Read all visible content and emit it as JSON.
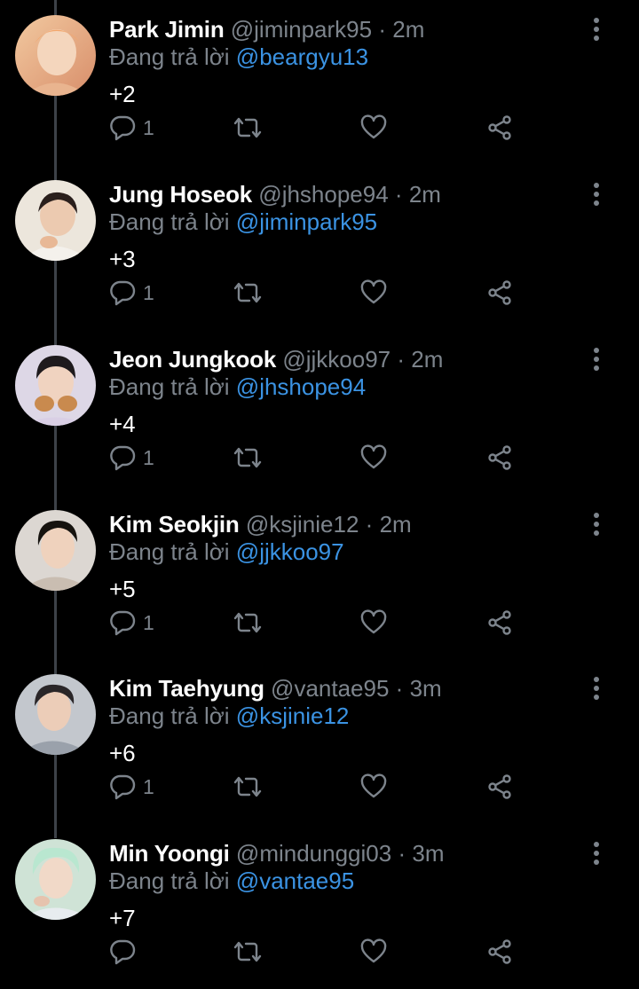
{
  "reply_prefix": "Đang trả lời",
  "colors": {
    "background": "#000000",
    "name": "#ffffff",
    "muted": "#7d848c",
    "link": "#3b93e3",
    "thread_line": "#3d4248"
  },
  "icons": {
    "reply": "reply-icon",
    "retweet": "retweet-icon",
    "like": "heart-icon",
    "share": "share-icon",
    "more": "more-vertical-icon"
  },
  "tweets": [
    {
      "name": "Park Jimin",
      "handle": "@jiminpark95",
      "separator": "·",
      "time": "2m",
      "reply_to": "@beargyu13",
      "text": "+2",
      "reply_count": "1"
    },
    {
      "name": "Jung Hoseok",
      "handle": "@jhshope94",
      "separator": "·",
      "time": "2m",
      "reply_to": "@jiminpark95",
      "text": "+3",
      "reply_count": "1"
    },
    {
      "name": "Jeon Jungkook",
      "handle": "@jjkkoo97",
      "separator": "·",
      "time": "2m",
      "reply_to": "@jhshope94",
      "text": "+4",
      "reply_count": "1"
    },
    {
      "name": "Kim Seokjin",
      "handle": "@ksjinie12",
      "separator": "·",
      "time": "2m",
      "reply_to": "@jjkkoo97",
      "text": "+5",
      "reply_count": "1"
    },
    {
      "name": "Kim Taehyung",
      "handle": "@vantae95",
      "separator": "·",
      "time": "3m",
      "reply_to": "@ksjinie12",
      "text": "+6",
      "reply_count": "1"
    },
    {
      "name": "Min Yoongi",
      "handle": "@mindunggi03",
      "separator": "·",
      "time": "3m",
      "reply_to": "@vantae95",
      "text": "+7",
      "reply_count": ""
    }
  ]
}
